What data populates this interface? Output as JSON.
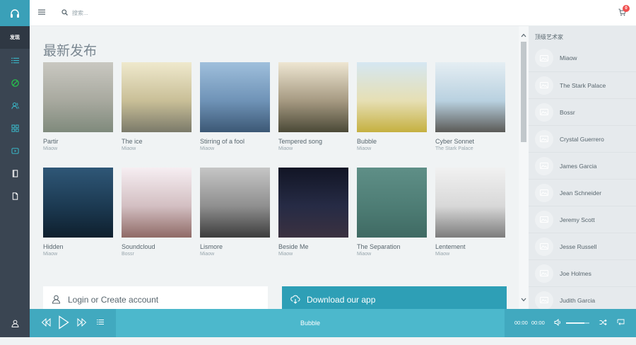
{
  "header": {
    "search_placeholder": "搜索...",
    "cart_count": "0"
  },
  "sidebar": {
    "active_label": "发现",
    "icons": [
      "list-icon",
      "disc-icon",
      "users-icon",
      "grid-icon",
      "video-icon",
      "book-icon",
      "file-icon"
    ]
  },
  "main": {
    "title": "最新发布",
    "cards": [
      {
        "title": "Partir",
        "artist": "Miaow",
        "colors": [
          "#c9c8c1",
          "#a8a99f",
          "#7f8a7c"
        ]
      },
      {
        "title": "The ice",
        "artist": "Miaow",
        "colors": [
          "#efe9cd",
          "#c9bf97",
          "#7b7a6a"
        ]
      },
      {
        "title": "Stirring of a fool",
        "artist": "Miaow",
        "colors": [
          "#9fbfdc",
          "#6f93b7",
          "#3c5875"
        ]
      },
      {
        "title": "Tempered song",
        "artist": "Miaow",
        "colors": [
          "#eee6d2",
          "#a69a82",
          "#4b4937"
        ]
      },
      {
        "title": "Bubble",
        "artist": "Miaow",
        "colors": [
          "#d5e7f2",
          "#e6dfb4",
          "#c5b040"
        ]
      },
      {
        "title": "Cyber Sonnet",
        "artist": "The Stark Palace",
        "colors": [
          "#e5eef3",
          "#b9d1e0",
          "#5b5a57"
        ]
      },
      {
        "title": "Hidden",
        "artist": "Miaow",
        "colors": [
          "#2f5777",
          "#1c3a52",
          "#0e1f2d"
        ]
      },
      {
        "title": "Soundcloud",
        "artist": "Bossr",
        "colors": [
          "#f6eef2",
          "#d3bfc2",
          "#8f6a66"
        ]
      },
      {
        "title": "Lismore",
        "artist": "Miaow",
        "colors": [
          "#c6c6c6",
          "#8f8f8f",
          "#3c3c3c"
        ]
      },
      {
        "title": "Beside Me",
        "artist": "Miaow",
        "colors": [
          "#121525",
          "#262b45",
          "#3b3140"
        ]
      },
      {
        "title": "The Separation",
        "artist": "Miaow",
        "colors": [
          "#5f8f87",
          "#4e7d75",
          "#3f6a63"
        ]
      },
      {
        "title": "Lentement",
        "artist": "Miaow",
        "colors": [
          "#f1f1f1",
          "#d8d8d8",
          "#7c7c7c"
        ]
      }
    ],
    "login_label": "Login or Create account",
    "download_label": "Download our app"
  },
  "right_panel": {
    "title": "顶级艺术家",
    "artists": [
      "Miaow",
      "The Stark Palace",
      "Bossr",
      "Crystal Guerrero",
      "James Garcia",
      "Jean Schneider",
      "Jeremy Scott",
      "Jesse Russell",
      "Joe Holmes",
      "Judith Garcia"
    ]
  },
  "player": {
    "now_playing": "Bubble",
    "current_time": "00:00",
    "total_time": "00:00",
    "volume": 0.8
  },
  "colors": {
    "accent": "#4cb8cc",
    "sidebar": "#3a4552"
  }
}
